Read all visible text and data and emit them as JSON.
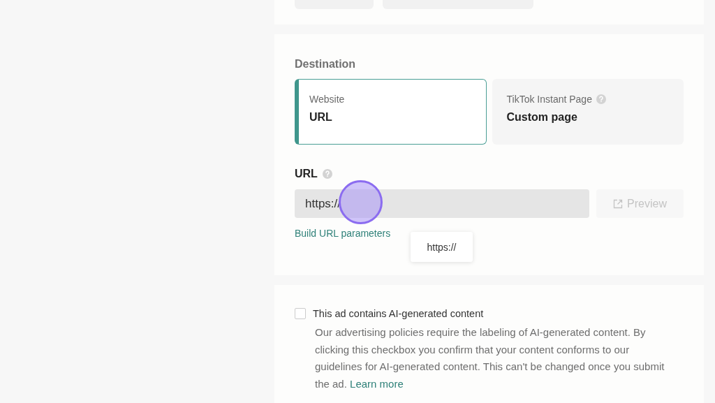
{
  "destination": {
    "title": "Destination",
    "options": [
      {
        "label": "Website",
        "value": "URL",
        "selected": true,
        "help": false
      },
      {
        "label": "TikTok Instant Page",
        "value": "Custom page",
        "selected": false,
        "help": true
      }
    ]
  },
  "url": {
    "label": "URL",
    "value": "https://",
    "preview_button": "Preview",
    "preview_disabled": true,
    "build_link": "Build URL parameters",
    "suggestion": "https://"
  },
  "ai_content": {
    "label": "This ad contains AI-generated content",
    "checked": false,
    "description": "Our advertising policies require the labeling of AI-generated content. By clicking this checkbox you confirm that your content conforms to our guidelines for AI-generated content. This can't be changed once you submit the ad.",
    "link": "Learn more"
  }
}
